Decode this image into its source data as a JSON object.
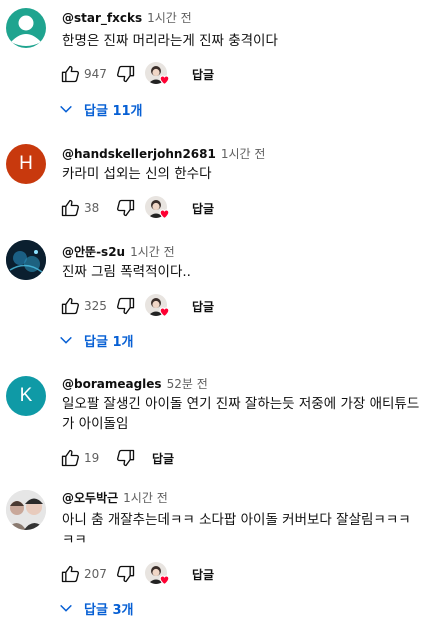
{
  "comments": [
    {
      "author": "@star_fxcks",
      "time": "1시간 전",
      "text": "한명은 진짜 머리라는게 진짜 충격이다",
      "likes": "947",
      "reply_label": "답글",
      "replies_label": "답글 11개",
      "avatar_color": "#1fa48f"
    },
    {
      "author": "@handskellerjohn2681",
      "time": "1시간 전",
      "text": "카라미 섭외는 신의 한수다",
      "likes": "38",
      "reply_label": "답글",
      "avatar_letter": "H",
      "avatar_color": "#c8390d"
    },
    {
      "author": "@안뚠-s2u",
      "time": "1시간 전",
      "text": "진짜 그림 폭력적이다..",
      "likes": "325",
      "reply_label": "답글",
      "replies_label": "답글 1개",
      "avatar_color": "#0e2a3e"
    },
    {
      "author": "@borameagles",
      "time": "52분 전",
      "text": "일오팔 잘생긴 아이돌 연기 진짜 잘하는듯 저중에 가장 애티튜드가 아이돌임",
      "likes": "19",
      "reply_label": "답글",
      "avatar_letter": "K",
      "avatar_color": "#0f9aa6"
    },
    {
      "author": "@오두박근",
      "time": "1시간 전",
      "text": "아니 춤 개잘추는데ㅋㅋ 소다팝 아이돌 커버보다 잘살림ㅋㅋㅋㅋㅋ",
      "likes": "207",
      "reply_label": "답글",
      "replies_label": "답글 3개",
      "avatar_color": "#d9d9d9"
    }
  ],
  "icons": {
    "like": "thumb-up-icon",
    "dislike": "thumb-down-icon",
    "creator_heart": "creator-heart-icon",
    "expand": "chevron-down-icon"
  },
  "colors": {
    "link": "#065fd4",
    "secondary_text": "#606060",
    "heart": "#ff0033"
  }
}
